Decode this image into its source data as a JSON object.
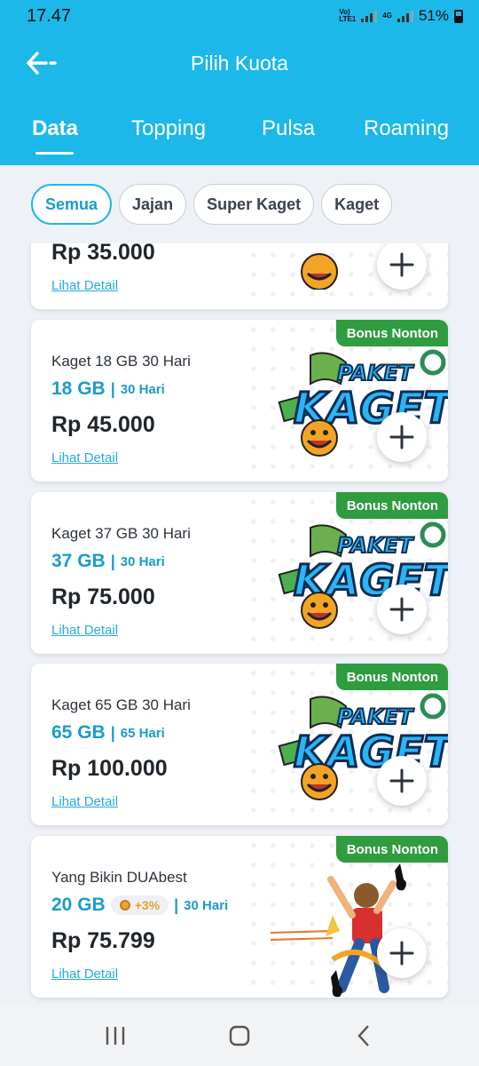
{
  "status_bar": {
    "time": "17.47",
    "net1_top": "Vo)",
    "net1_bot": "LTE1",
    "net2": "4G",
    "battery": "51%"
  },
  "header": {
    "title": "Pilih Kuota"
  },
  "tabs": [
    {
      "label": "Data"
    },
    {
      "label": "Topping"
    },
    {
      "label": "Pulsa"
    },
    {
      "label": "Roaming"
    }
  ],
  "filters": [
    {
      "label": "Semua"
    },
    {
      "label": "Jajan"
    },
    {
      "label": "Super Kaget"
    },
    {
      "label": "Kaget"
    }
  ],
  "products": [
    {
      "price": "Rp 35.000",
      "detail_link": "Lihat Detail"
    },
    {
      "badge": "Bonus Nonton",
      "name": "Kaget 18 GB 30 Hari",
      "quota": "18 GB",
      "separator": "|",
      "duration": "30 Hari",
      "price": "Rp 45.000",
      "detail_link": "Lihat Detail"
    },
    {
      "badge": "Bonus Nonton",
      "name": "Kaget 37 GB 30 Hari",
      "quota": "37 GB",
      "separator": "|",
      "duration": "30 Hari",
      "price": "Rp 75.000",
      "detail_link": "Lihat Detail"
    },
    {
      "badge": "Bonus Nonton",
      "name": "Kaget 65 GB 30 Hari",
      "quota": "65 GB",
      "separator": "|",
      "duration": "65 Hari",
      "price": "Rp 100.000",
      "detail_link": "Lihat Detail"
    },
    {
      "badge": "Bonus Nonton",
      "name": "Yang Bikin DUAbest",
      "quota": "20 GB",
      "bonus": "+3%",
      "separator": "|",
      "duration": "30 Hari",
      "price": "Rp 75.799",
      "detail_link": "Lihat Detail"
    }
  ],
  "art_text": {
    "line1": "PAKET",
    "line2": "KAGET"
  },
  "colors": {
    "primary": "#1cb8ea",
    "badge": "#2e9c3f",
    "link": "#27aadf"
  }
}
